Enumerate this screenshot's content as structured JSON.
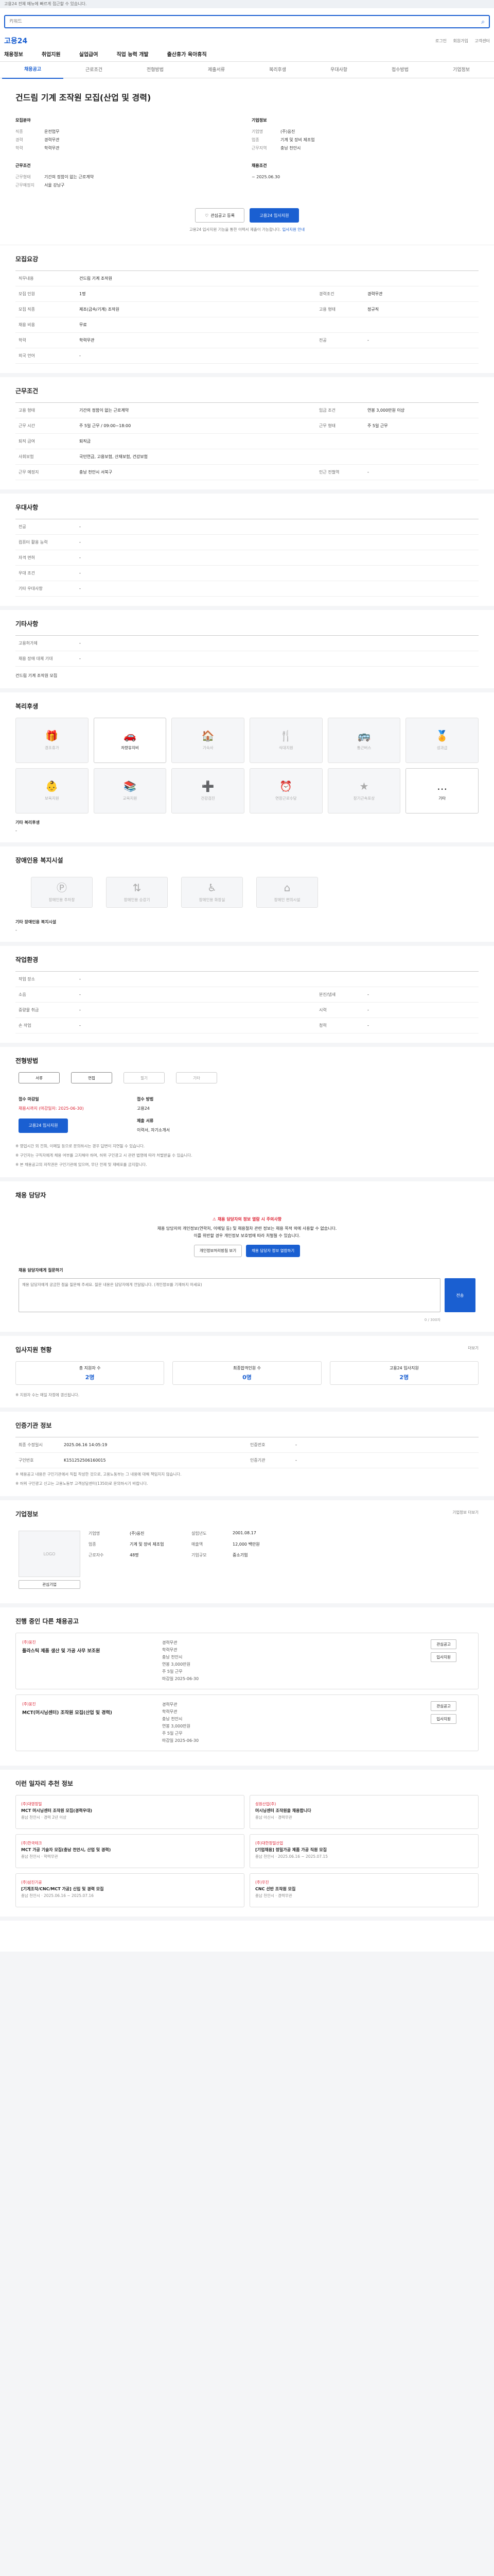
{
  "notice": "고용24 전체 메뉴에 빠르게 접근할 수 있습니다.",
  "search": {
    "placeholder": "키워드"
  },
  "globe_links": [
    "로그인",
    "회원가입",
    "고객센터"
  ],
  "logo": "고용24",
  "gnb": [
    "채용정보",
    "취업지원",
    "실업급여",
    "직업 능력 개발",
    "출산휴가 육아휴직"
  ],
  "tabs": [
    "채용공고",
    "근로조건",
    "전형방법",
    "제출서류",
    "복리후생",
    "우대사항",
    "접수방법",
    "기업정보"
  ],
  "hero": {
    "title": "건드림 기계 조작원 모집(산업 및 경력)",
    "labels": {
      "job": "모집분야",
      "company": "기업정보",
      "cond": "근무조건",
      "app": "채용조건"
    },
    "rows": [
      {
        "k": "직종",
        "v": "운전업무"
      },
      {
        "k": "경력",
        "v": "경력무관"
      },
      {
        "k": "학력",
        "v": "학력무관"
      },
      {
        "k": "근무형태",
        "v": "기간의 정함이 없는 근로계약"
      },
      {
        "k": "근무예정지",
        "v": "서울 강남구"
      },
      {
        "k": "기업명",
        "v": "(주)웅진"
      },
      {
        "k": "업종",
        "v": "기계 및 장비 제조업"
      },
      {
        "k": "근무지역",
        "v": "충남 천안시"
      }
    ],
    "apply_date": "~ 2025.06.30",
    "scrap_label": "관심공고 등록",
    "apply_label": "고용24 입사지원",
    "hint": "고용24 입사지원 기능을 통한 이력서 제출이 가능합니다.",
    "hint_link": "입사지원 안내"
  },
  "sections": {
    "summary": "모집요강",
    "conditions": "근무조건",
    "preference": "우대사항",
    "etc": "기타사항",
    "welfare": "복리후생",
    "disabled": "장애인용 복지시설",
    "env": "작업환경",
    "selection": "전형방법",
    "manager": "채용 담당자",
    "stats": "입사지원 현황",
    "info": "인증기관 정보",
    "company": "기업정보",
    "other_jobs": "진행 중인 다른 채용공고",
    "recommended": "이런 일자리 추천 정보"
  },
  "summary_rows": [
    {
      "k": "직무내용",
      "v": "건드림 기계 조작원"
    },
    {
      "k": "모집 인원",
      "v": "1명",
      "k2": "경력조건",
      "v2": "경력무관"
    },
    {
      "k": "모집 직종",
      "v": "제조(금속/기계) 조작원",
      "k2": "고용 형태",
      "v2": "정규직"
    },
    {
      "k": "채용 비용",
      "v": "무료"
    },
    {
      "k": "학력",
      "v": "학력무관",
      "k2": "전공",
      "v2": "-"
    },
    {
      "k": "외국 언어",
      "v": "-"
    }
  ],
  "cond_rows": [
    {
      "k": "고용 형태",
      "v": "기간의 정함이 없는 근로계약",
      "k2": "임금 조건",
      "v2": "연봉 3,000만원 이상"
    },
    {
      "k": "근무 시간",
      "v": "주 5일 근무 / 09:00~18:00",
      "k2": "근무 형태",
      "v2": "주 5일 근무"
    },
    {
      "k": "퇴직 급여",
      "v": "퇴직금"
    },
    {
      "k": "사회보험",
      "v": "국민연금, 고용보험, 산재보험, 건강보험"
    },
    {
      "k": "근무 예정지",
      "v": "충남 천안시 서북구",
      "k2": "인근 전철역",
      "v2": "-"
    }
  ],
  "pref_rows": [
    {
      "k": "전공",
      "v": "-"
    },
    {
      "k": "컴퓨터 활용 능력",
      "v": "-"
    },
    {
      "k": "자격 면허",
      "v": "-"
    },
    {
      "k": "우대 조건",
      "v": "-"
    },
    {
      "k": "기타 우대사항",
      "v": "-"
    }
  ],
  "etc_rows": [
    {
      "k": "고용허가제",
      "v": "-"
    },
    {
      "k": "채용 장애 대체 기대",
      "v": "-"
    }
  ],
  "etc_text": "건드림 기계 조작원 모집",
  "welfare_items": [
    {
      "icon": "gift-icon",
      "glyph": "🎁",
      "label": "경조휴가",
      "on": false
    },
    {
      "icon": "car-icon",
      "glyph": "🚗",
      "label": "차량유지비",
      "on": true
    },
    {
      "icon": "dorm-icon",
      "glyph": "🏠",
      "label": "기숙사",
      "on": false
    },
    {
      "icon": "meal-icon",
      "glyph": "🍴",
      "label": "식대지원",
      "on": false
    },
    {
      "icon": "bus-icon",
      "glyph": "🚌",
      "label": "통근버스",
      "on": false
    },
    {
      "icon": "medal-icon",
      "glyph": "🏅",
      "label": "성과급",
      "on": false
    },
    {
      "icon": "child-icon",
      "glyph": "👶",
      "label": "보육지원",
      "on": false
    },
    {
      "icon": "book-icon",
      "glyph": "📚",
      "label": "교육지원",
      "on": false
    },
    {
      "icon": "health-icon",
      "glyph": "➕",
      "label": "건강검진",
      "on": false
    },
    {
      "icon": "clock-icon",
      "glyph": "⏰",
      "label": "연장근로수당",
      "on": false
    },
    {
      "icon": "star-icon",
      "glyph": "★",
      "label": "장기근속포상",
      "on": false
    },
    {
      "icon": "etc-icon",
      "glyph": "…",
      "label": "기타",
      "on": true
    }
  ],
  "welfare_etc_label": "기타 복리후생",
  "welfare_etc_value": "-",
  "disabled_items": [
    "장애인용 주차장",
    "장애인용 승강기",
    "장애인용 화장실",
    "장애인 편의시설"
  ],
  "disabled_etc_label": "기타 장애인용 복지시설",
  "disabled_etc_value": "-",
  "env_rows": [
    {
      "k": "작업 장소",
      "v": "-"
    },
    {
      "k": "소음",
      "v": "-",
      "k2": "분진/냄새",
      "v2": "-"
    },
    {
      "k": "중량물 취급",
      "v": "-",
      "k2": "시력",
      "v2": "-"
    },
    {
      "k": "손 작업",
      "v": "-",
      "k2": "청력",
      "v2": "-"
    }
  ],
  "selection": {
    "pills": [
      "서류",
      "면접",
      "필기",
      "기타"
    ],
    "pills_on": [
      true,
      true,
      false,
      false
    ],
    "deadline_label": "접수 마감일",
    "deadline": "채용시까지 (마감일자: 2025-06-30)",
    "method_label": "접수 방법",
    "method": "고용24",
    "docs_label": "제출 서류",
    "docs": "이력서, 자기소개서",
    "apply_btn": "고용24 입사지원",
    "notes": [
      "※ 영업시간 외 전화, 이메일 등으로 문의하시는 경우 답변이 지연될 수 있습니다.",
      "※ 구인자는 구직자에게 채용 여부를 고지해야 하며, 허위 구인광고 시 관련 법령에 따라 처벌받을 수 있습니다.",
      "※ 본 채용공고의 저작권은 구인기관에 있으며, 무단 전재 및 재배포를 금지합니다."
    ]
  },
  "manager": {
    "warn": "채용 담당자의 정보 열람 시 주의사항",
    "line1": "채용 담당자의 개인정보(연락처, 이메일 등) 및 채용절차 관련 정보는 채용 목적 외에 사용할 수 없습니다.",
    "line2": "이를 위반할 경우 개인정보 보호법에 따라 처벌될 수 있습니다.",
    "btn_view": "개인정보처리방침 보기",
    "btn_contact": "채용 담당자 정보 열람하기",
    "ask_label": "채용 담당자에게 질문하기",
    "ask_placeholder": "채용 담당자에게 궁금한 점을 질문해 주세요. 질문 내용은 담당자에게 전달됩니다. (개인정보를 기재하지 마세요)",
    "send": "전송",
    "counter": "0 / 300자"
  },
  "stats": [
    {
      "label": "총 지원자 수",
      "value": "2명"
    },
    {
      "label": "최종합격인원 수",
      "value": "0명"
    },
    {
      "label": "고용24 입사지원",
      "value": "2명"
    }
  ],
  "stats_note": "※ 지원자 수는 매일 자정에 갱신됩니다.",
  "stats_more": "더보기",
  "info_rows": [
    {
      "k": "최종 수정일시",
      "v": "2025.06.16 14:05:19",
      "k2": "인증번호",
      "v2": "-"
    },
    {
      "k": "구인번호",
      "v": "K151252506160015",
      "k2": "인증기관",
      "v2": "-"
    }
  ],
  "info_notes": [
    "※ 채용공고 내용은 구인기관에서 직접 작성한 것으로, 고용노동부는 그 내용에 대해 책임지지 않습니다.",
    "※ 허위 구인광고 신고는 고용노동부 고객상담센터(1350)로 문의하시기 바랍니다."
  ],
  "company": {
    "logo_text": "LOGO",
    "scrap": "관심기업",
    "more": "기업정보 더보기",
    "rows": [
      {
        "k": "기업명",
        "v": "(주)웅진"
      },
      {
        "k": "설립년도",
        "v": "2001.08.17"
      },
      {
        "k": "업종",
        "v": "기계 및 장비 제조업"
      },
      {
        "k": "매출액",
        "v": "12,000 백만원"
      },
      {
        "k": "근로자수",
        "v": "48명"
      },
      {
        "k": "기업규모",
        "v": "중소기업"
      }
    ]
  },
  "other_jobs": [
    {
      "org": "(주)웅진",
      "title": "플라스틱 제품 생산 및 가공 사무 보조원",
      "meta": [
        "경력무관",
        "학력무관",
        "충남 천안시",
        "연봉 3,000만원",
        "주 5일 근무"
      ],
      "deadline": "마감일 2025-06-30",
      "btn1": "관심공고",
      "btn2": "입사지원"
    },
    {
      "org": "(주)웅진",
      "title": "MCT(머시닝센터) 조작원 모집(산업 및 경력)",
      "meta": [
        "경력무관",
        "학력무관",
        "충남 천안시",
        "연봉 3,000만원",
        "주 5일 근무"
      ],
      "deadline": "마감일 2025-06-30",
      "btn1": "관심공고",
      "btn2": "입사지원"
    }
  ],
  "recommended": [
    {
      "org": "(주)대영정밀",
      "title": "MCT 머시닝센터 조작원 모집(경력우대)",
      "meta": "충남 천안시 · 경력 2년 이상"
    },
    {
      "org": "성원산업(주)",
      "title": "머시닝센터 조작원을 채용합니다",
      "meta": "충남 아산시 · 경력무관"
    },
    {
      "org": "(주)한국테크",
      "title": "MCT 가공 기술자 모집(충남 천안시, 산업 및 경력)",
      "meta": "충남 천안시 · 학력무관"
    },
    {
      "org": "(주)대한정밀산업",
      "title": "[기업채용] 정밀가공 제품 가공 직원 모집",
      "meta": "충남 천안시 · 2025.06.16 ~ 2025.07.15"
    },
    {
      "org": "(주)삼진기공",
      "title": "[기계조작/CNC/MCT 가공] 신입 및 경력 모집",
      "meta": "충남 천안시 · 2025.06.16 ~ 2025.07.16"
    },
    {
      "org": "(주)우진",
      "title": "CNC 선반 조작원 모집",
      "meta": "충남 천안시 · 경력무관"
    }
  ]
}
